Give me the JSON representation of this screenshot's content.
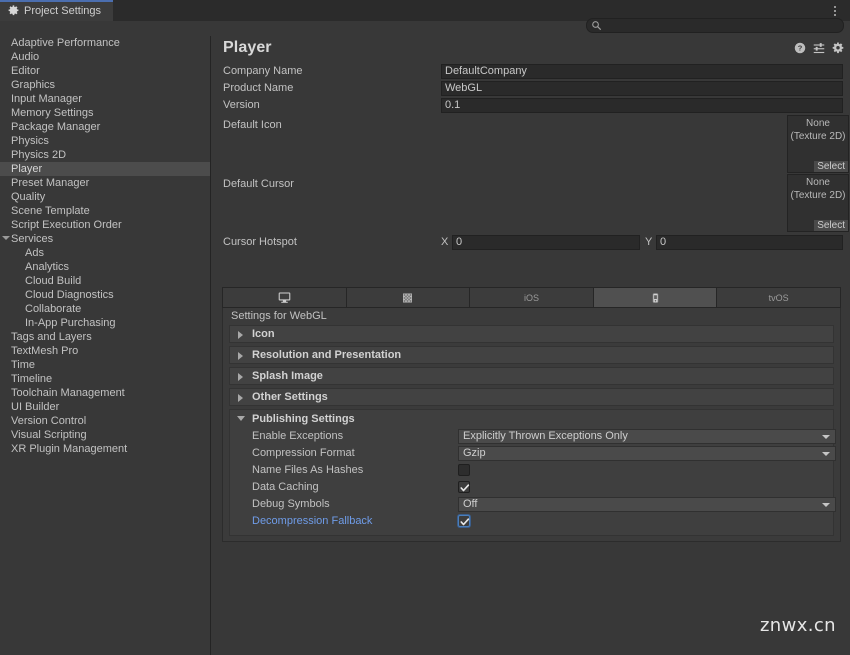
{
  "window": {
    "tab_label": "Project Settings",
    "tab_icon": "gear-icon",
    "menu_icon": "kebab-menu-icon"
  },
  "search": {
    "value": "",
    "placeholder": "",
    "icon": "search-icon"
  },
  "sidebar": {
    "items": [
      {
        "label": "Adaptive Performance",
        "level": 0,
        "selected": false,
        "expander": ""
      },
      {
        "label": "Audio",
        "level": 0,
        "selected": false,
        "expander": ""
      },
      {
        "label": "Editor",
        "level": 0,
        "selected": false,
        "expander": ""
      },
      {
        "label": "Graphics",
        "level": 0,
        "selected": false,
        "expander": ""
      },
      {
        "label": "Input Manager",
        "level": 0,
        "selected": false,
        "expander": ""
      },
      {
        "label": "Memory Settings",
        "level": 0,
        "selected": false,
        "expander": ""
      },
      {
        "label": "Package Manager",
        "level": 0,
        "selected": false,
        "expander": ""
      },
      {
        "label": "Physics",
        "level": 0,
        "selected": false,
        "expander": ""
      },
      {
        "label": "Physics 2D",
        "level": 0,
        "selected": false,
        "expander": ""
      },
      {
        "label": "Player",
        "level": 0,
        "selected": true,
        "expander": ""
      },
      {
        "label": "Preset Manager",
        "level": 0,
        "selected": false,
        "expander": ""
      },
      {
        "label": "Quality",
        "level": 0,
        "selected": false,
        "expander": ""
      },
      {
        "label": "Scene Template",
        "level": 0,
        "selected": false,
        "expander": ""
      },
      {
        "label": "Script Execution Order",
        "level": 0,
        "selected": false,
        "expander": ""
      },
      {
        "label": "Services",
        "level": 0,
        "selected": false,
        "expander": "expanded"
      },
      {
        "label": "Ads",
        "level": 1,
        "selected": false,
        "expander": ""
      },
      {
        "label": "Analytics",
        "level": 1,
        "selected": false,
        "expander": ""
      },
      {
        "label": "Cloud Build",
        "level": 1,
        "selected": false,
        "expander": ""
      },
      {
        "label": "Cloud Diagnostics",
        "level": 1,
        "selected": false,
        "expander": ""
      },
      {
        "label": "Collaborate",
        "level": 1,
        "selected": false,
        "expander": ""
      },
      {
        "label": "In-App Purchasing",
        "level": 1,
        "selected": false,
        "expander": ""
      },
      {
        "label": "Tags and Layers",
        "level": 0,
        "selected": false,
        "expander": ""
      },
      {
        "label": "TextMesh Pro",
        "level": 0,
        "selected": false,
        "expander": ""
      },
      {
        "label": "Time",
        "level": 0,
        "selected": false,
        "expander": ""
      },
      {
        "label": "Timeline",
        "level": 0,
        "selected": false,
        "expander": ""
      },
      {
        "label": "Toolchain Management",
        "level": 0,
        "selected": false,
        "expander": ""
      },
      {
        "label": "UI Builder",
        "level": 0,
        "selected": false,
        "expander": ""
      },
      {
        "label": "Version Control",
        "level": 0,
        "selected": false,
        "expander": ""
      },
      {
        "label": "Visual Scripting",
        "level": 0,
        "selected": false,
        "expander": ""
      },
      {
        "label": "XR Plugin Management",
        "level": 0,
        "selected": false,
        "expander": ""
      }
    ]
  },
  "main": {
    "title": "Player",
    "header_icons": [
      "help-icon",
      "preset-icon",
      "gear-icon"
    ],
    "fields": {
      "company_name_label": "Company Name",
      "company_name_value": "DefaultCompany",
      "product_name_label": "Product Name",
      "product_name_value": "WebGL",
      "version_label": "Version",
      "version_value": "0.1",
      "default_icon_label": "Default Icon",
      "default_cursor_label": "Default Cursor",
      "cursor_hotspot_label": "Cursor Hotspot",
      "hotspot_x_tag": "X",
      "hotspot_x_value": "0",
      "hotspot_y_tag": "Y",
      "hotspot_y_value": "0"
    },
    "object_picker": {
      "none_line1": "None",
      "none_line2": "(Texture 2D)",
      "select_label": "Select"
    },
    "platform_tabs": [
      {
        "label": "",
        "icon": "desktop-icon",
        "active": false
      },
      {
        "label": "",
        "icon": "android-icon",
        "active": false
      },
      {
        "label": "iOS",
        "icon": "",
        "active": false
      },
      {
        "label": "",
        "icon": "webgl-icon",
        "active": true
      },
      {
        "label": "tvOS",
        "icon": "",
        "active": false
      }
    ],
    "settings_for": "Settings for WebGL",
    "foldouts": [
      {
        "label": "Icon",
        "expanded": false
      },
      {
        "label": "Resolution and Presentation",
        "expanded": false
      },
      {
        "label": "Splash Image",
        "expanded": false
      },
      {
        "label": "Other Settings",
        "expanded": false
      }
    ],
    "publishing": {
      "title": "Publishing Settings",
      "rows": [
        {
          "label": "Enable Exceptions",
          "type": "dropdown",
          "value": "Explicitly Thrown Exceptions Only",
          "checked": false,
          "focused": false,
          "highlight": false
        },
        {
          "label": "Compression Format",
          "type": "dropdown",
          "value": "Gzip",
          "checked": false,
          "focused": false,
          "highlight": false
        },
        {
          "label": "Name Files As Hashes",
          "type": "checkbox",
          "value": "",
          "checked": false,
          "focused": false,
          "highlight": false
        },
        {
          "label": "Data Caching",
          "type": "checkbox",
          "value": "",
          "checked": true,
          "focused": false,
          "highlight": false
        },
        {
          "label": "Debug Symbols",
          "type": "dropdown",
          "value": "Off",
          "checked": false,
          "focused": false,
          "highlight": false
        },
        {
          "label": "Decompression Fallback",
          "type": "checkbox",
          "value": "",
          "checked": true,
          "focused": true,
          "highlight": true
        }
      ]
    }
  },
  "watermark": {
    "text": "znwx.cn"
  },
  "colors": {
    "app_background": "#383838",
    "titlebar": "#2b2b2b",
    "tab_accent": "#4b6eaf",
    "selection": "#4c4c4c",
    "link": "#6f9ce8",
    "focus_border": "#4a7ebb"
  }
}
